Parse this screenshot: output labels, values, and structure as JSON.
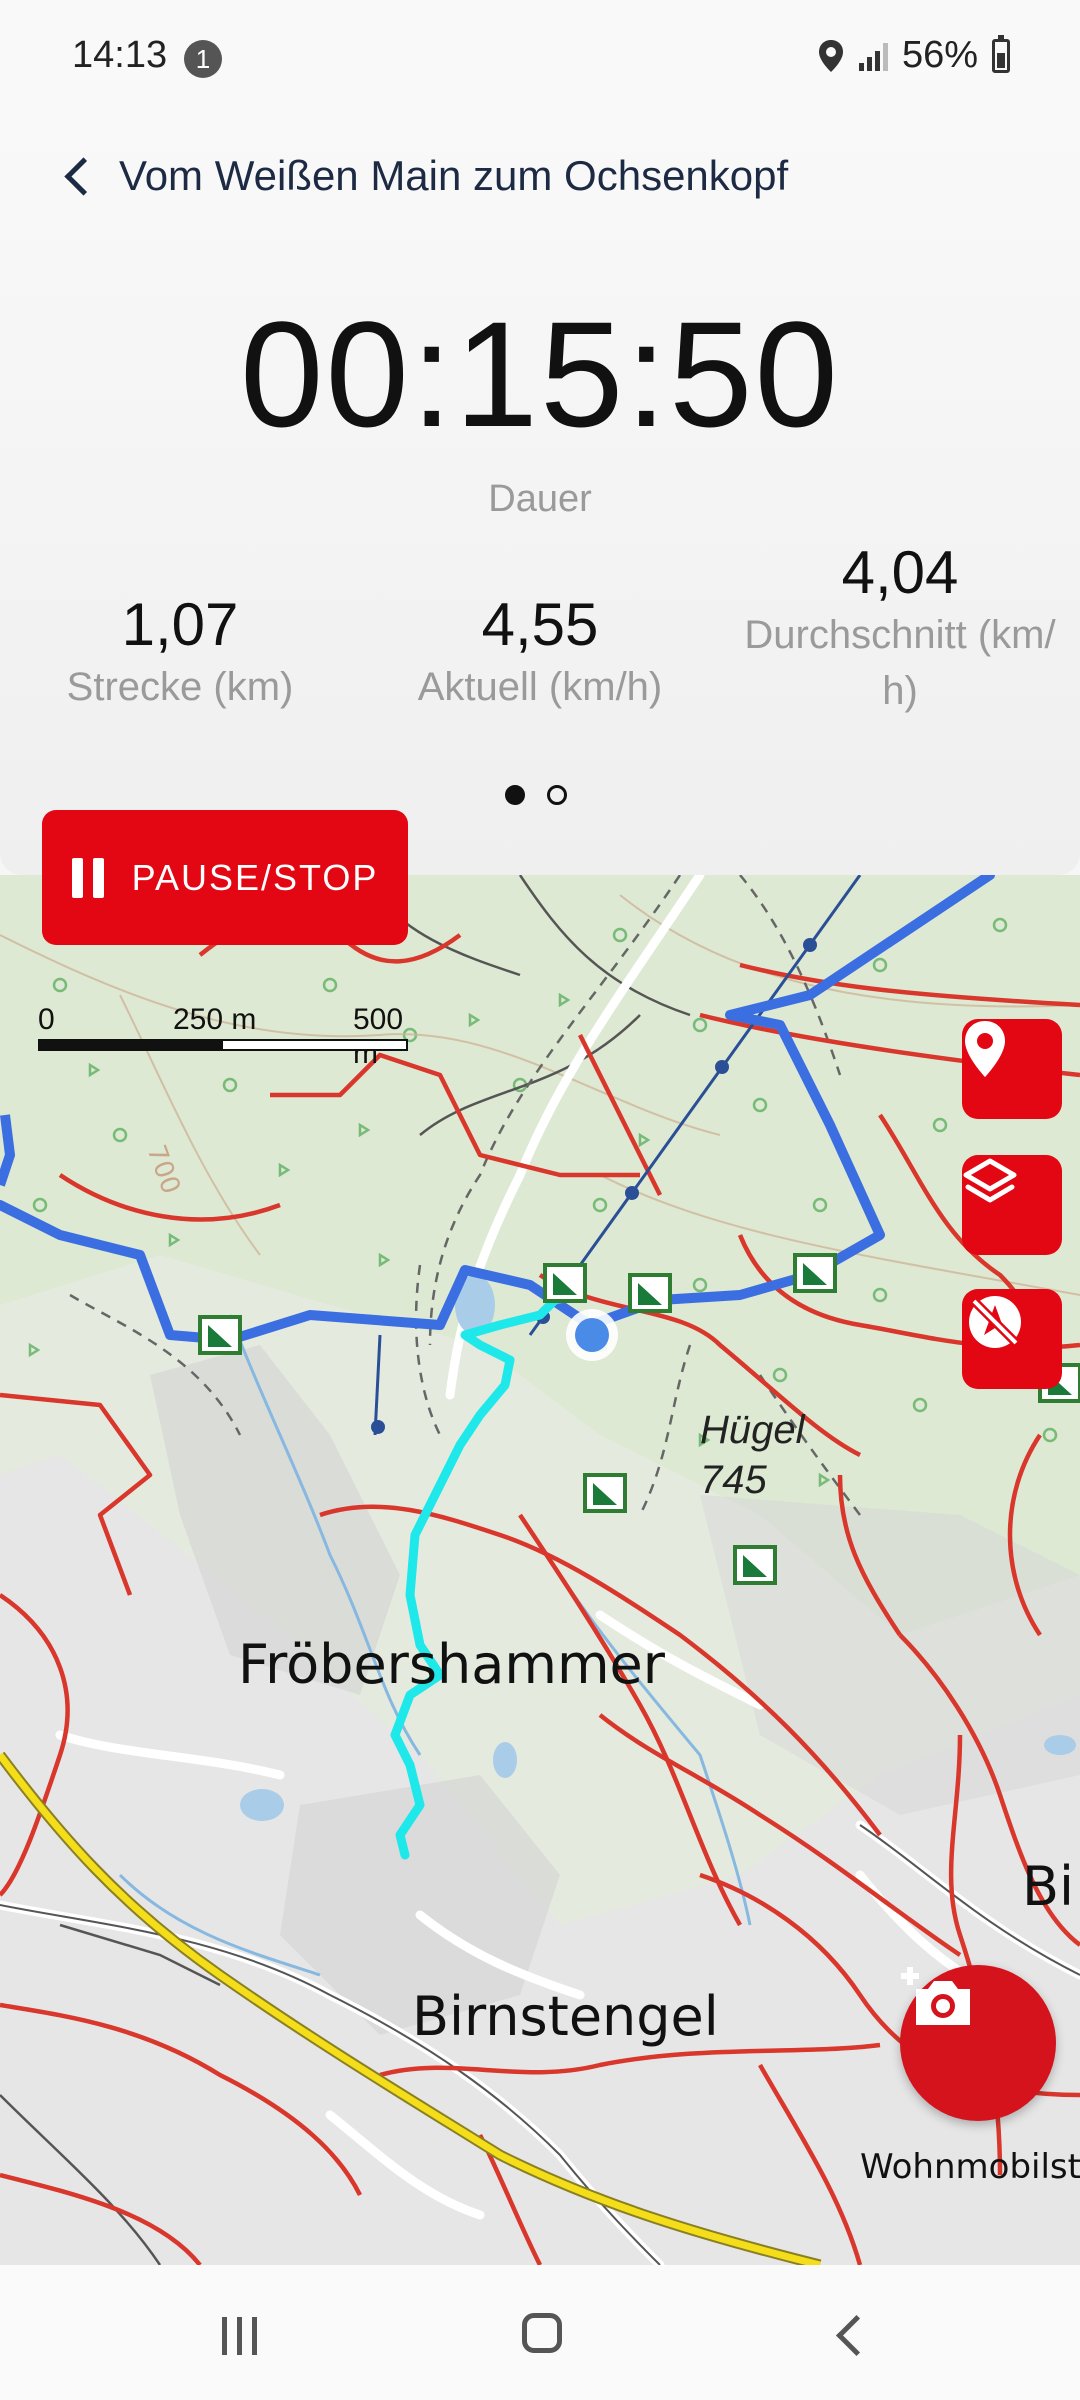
{
  "status_bar": {
    "time": "14:13",
    "notification_count": "1",
    "battery": "56%"
  },
  "header": {
    "title": "Vom Weißen Main zum Ochsenkopf"
  },
  "timer": {
    "value": "00:15:50",
    "label": "Dauer"
  },
  "stats": [
    {
      "value": "1,07",
      "label": "Strecke (km)"
    },
    {
      "value": "4,55",
      "label": "Aktuell (km/h)"
    },
    {
      "value": "4,04",
      "label": "Durchschnitt (km/ h)"
    }
  ],
  "pager": {
    "pages": 2,
    "active": 1
  },
  "map": {
    "scale": {
      "labels": [
        "0",
        "250 m",
        "500 m"
      ]
    },
    "pause_button_label": "PAUSE/STOP",
    "places": {
      "town1": "Fröbershammer",
      "town2": "Birnstengel",
      "partial_town": "Bi",
      "camp": "Wohnmobilste"
    },
    "hill": {
      "name": "Hügel",
      "elevation": "745"
    },
    "contour_label": "700",
    "buttons": [
      "location-pin-icon",
      "layers-icon",
      "navigation-off-icon",
      "add-photo-icon"
    ]
  },
  "colors": {
    "accent_red": "#e30613",
    "route_blue": "#3b6ee0",
    "track_cyan": "#1fe8ea",
    "trail_red": "#d9362c",
    "road_yellow": "#f4de1a"
  }
}
